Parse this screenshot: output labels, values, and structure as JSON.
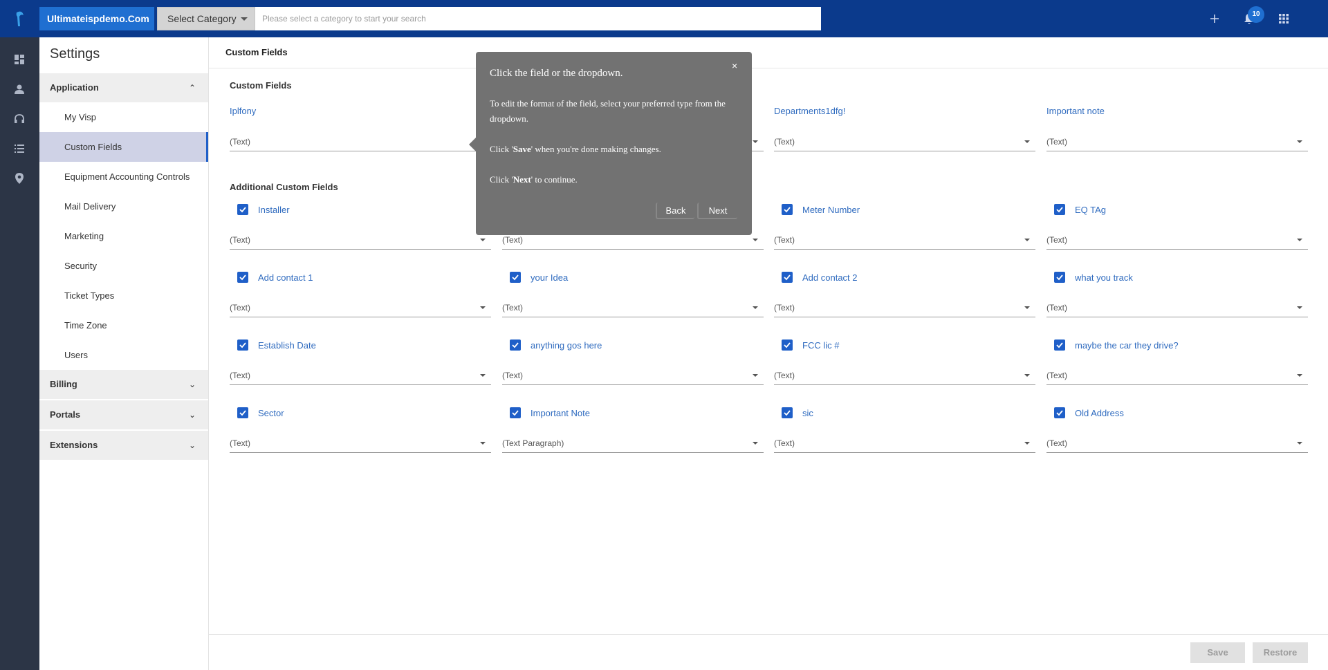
{
  "header": {
    "brand": "Ultimateispdemo.Com",
    "category_select": "Select Category",
    "search_placeholder": "Please select a category to start your search",
    "notification_count": "10"
  },
  "sidebar": {
    "title": "Settings",
    "application": {
      "label": "Application",
      "items": [
        "My Visp",
        "Custom Fields",
        "Equipment Accounting Controls",
        "Mail Delivery",
        "Marketing",
        "Security",
        "Ticket Types",
        "Time Zone",
        "Users"
      ]
    },
    "billing": "Billing",
    "portals": "Portals",
    "extensions": "Extensions"
  },
  "main": {
    "title": "Custom Fields",
    "custom_fields_heading": "Custom Fields",
    "custom_fields": [
      {
        "label": "Iplfony",
        "type": "(Text)"
      },
      {
        "label": "",
        "type": ""
      },
      {
        "label": "Departments1dfg!",
        "type": "(Text)"
      },
      {
        "label": "Important note",
        "type": "(Text)"
      }
    ],
    "additional_heading": "Additional Custom Fields",
    "additional_fields": [
      {
        "label": "Installer",
        "type": "(Text)"
      },
      {
        "label": "",
        "type": "(Text)"
      },
      {
        "label": "Meter Number",
        "type": "(Text)"
      },
      {
        "label": "EQ TAg",
        "type": "(Text)"
      },
      {
        "label": "Add contact 1",
        "type": "(Text)"
      },
      {
        "label": "your Idea",
        "type": "(Text)"
      },
      {
        "label": "Add contact 2",
        "type": "(Text)"
      },
      {
        "label": "what you track",
        "type": "(Text)"
      },
      {
        "label": "Establish Date",
        "type": "(Text)"
      },
      {
        "label": "anything gos here",
        "type": "(Text)"
      },
      {
        "label": "FCC lic #",
        "type": "(Text)"
      },
      {
        "label": "maybe the car they drive?",
        "type": "(Text)"
      },
      {
        "label": "Sector",
        "type": "(Text)"
      },
      {
        "label": "Important Note",
        "type": "(Text Paragraph)"
      },
      {
        "label": "sic",
        "type": "(Text)"
      },
      {
        "label": "Old Address",
        "type": "(Text)"
      }
    ]
  },
  "footer": {
    "save": "Save",
    "restore": "Restore"
  },
  "tour": {
    "close": "×",
    "title": "Click the field or the dropdown.",
    "p1": "To edit the format of the field, select your preferred type from the dropdown.",
    "p2_pre": "Click '",
    "p2_bold": "Save",
    "p2_post": "' when you're done making changes.",
    "p3_pre": "Click '",
    "p3_bold": "Next",
    "p3_post": "' to continue.",
    "back": "Back",
    "next": "Next"
  },
  "colors": {
    "topbar": "#0b3a8c",
    "accent": "#1f6fd1",
    "rail": "#2c3546",
    "label_blue": "#2f6bbf",
    "tour_bg": "#727272"
  }
}
